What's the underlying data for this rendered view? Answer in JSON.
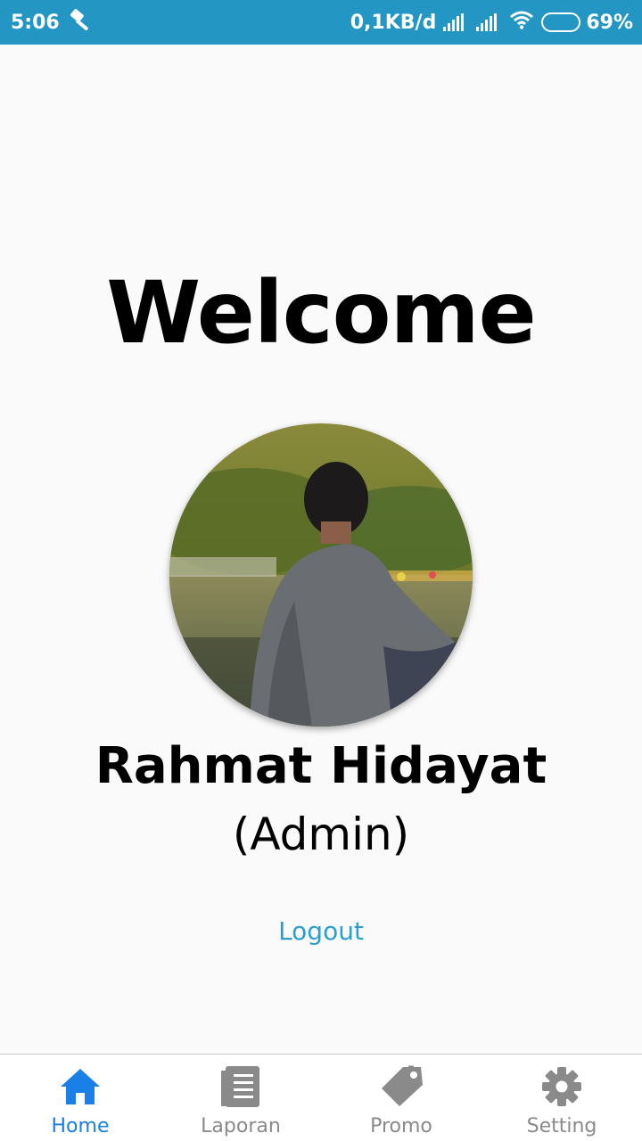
{
  "status_bar": {
    "time": "5:06",
    "network_speed": "0,1KB/d",
    "battery_percent": "69%",
    "battery_level": 0.69,
    "notification_icon": "hammer-icon",
    "background_color": "#2496c4"
  },
  "main": {
    "welcome_text": "Welcome",
    "user_name": "Rahmat Hidayat",
    "user_role": "(Admin)",
    "logout_label": "Logout",
    "logout_color": "#2b9fcf"
  },
  "bottom_nav": {
    "active_color": "#1a7fe6",
    "inactive_color": "#8a8a8a",
    "items": [
      {
        "label": "Home",
        "icon": "home-icon",
        "active": true
      },
      {
        "label": "Laporan",
        "icon": "report-icon",
        "active": false
      },
      {
        "label": "Promo",
        "icon": "tag-icon",
        "active": false
      },
      {
        "label": "Setting",
        "icon": "gear-icon",
        "active": false
      }
    ]
  }
}
